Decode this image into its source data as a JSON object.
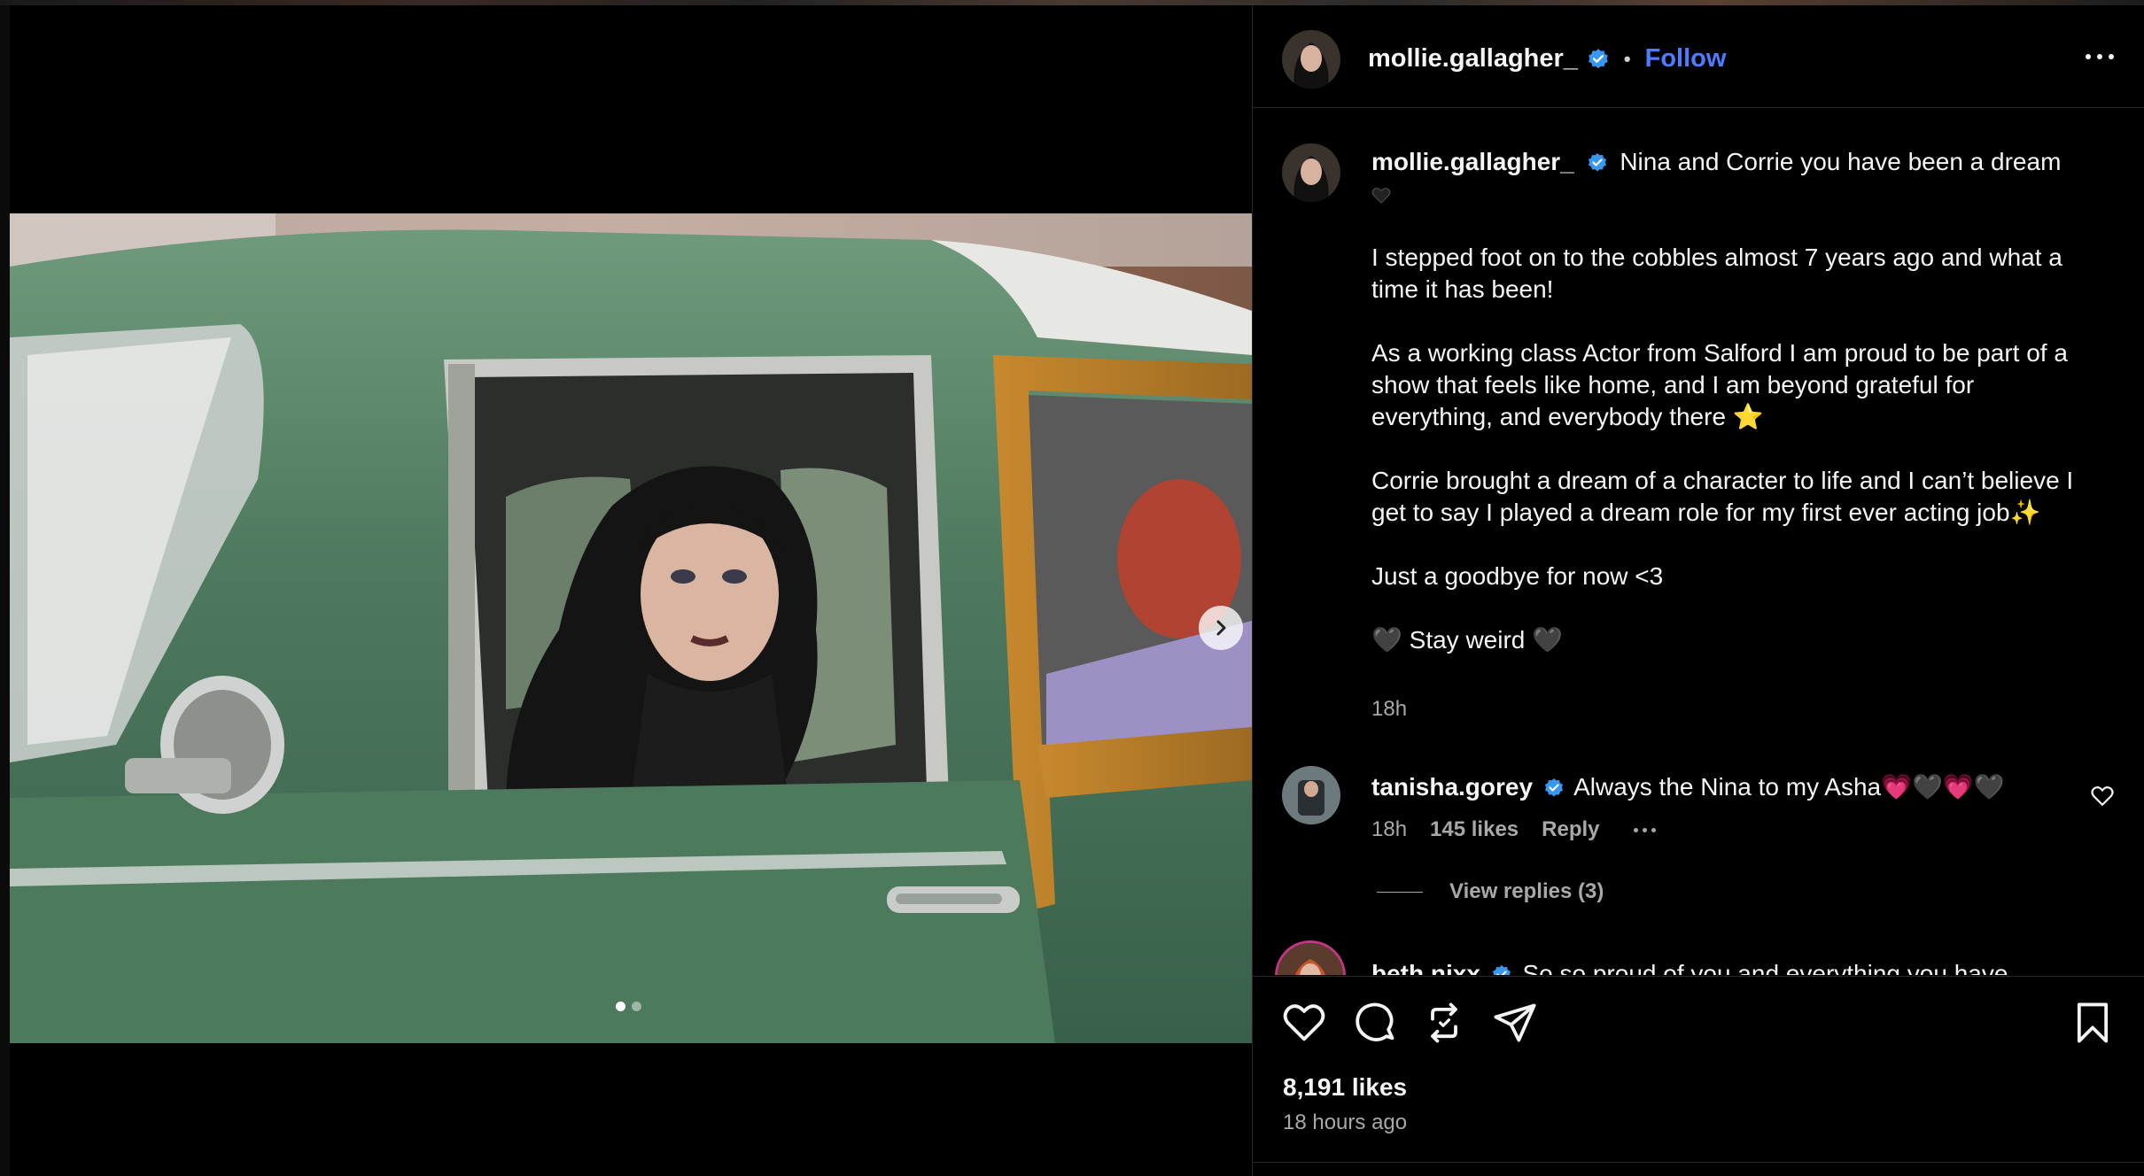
{
  "post": {
    "author": "mollie.gallagher_",
    "follow_label": "Follow",
    "separator": "•",
    "caption": {
      "username": "mollie.gallagher_",
      "line1": "Nina and Corrie you have been a dream",
      "paragraphs": [
        "I stepped foot on to the cobbles almost 7 years ago and what a time it has been!",
        "As a working class Actor from Salford I am proud to be part of a show that feels like home, and I am beyond grateful for everything, and everybody there ⭐",
        "Corrie brought a dream of a character to life and I can’t believe I get to say I played a dream role for my first ever acting job✨",
        "Just a goodbye for now <3",
        "🖤 Stay weird 🖤"
      ],
      "time": "18h"
    },
    "likes": "8,191 likes",
    "time_ago": "18 hours ago",
    "carousel": {
      "current": 1,
      "total": 2
    }
  },
  "comments": [
    {
      "username": "tanisha.gorey",
      "text": "Always the Nina to my Asha💗🖤💗🖤",
      "time": "18h",
      "likes": "145 likes",
      "reply_label": "Reply",
      "view_replies": "View replies (3)"
    },
    {
      "username": "beth.nixx",
      "text": "So so proud of you and everything you have"
    }
  ],
  "icons": {
    "verified": "verified-badge-icon",
    "more": "more-options-icon",
    "like": "heart-icon",
    "comment": "comment-icon",
    "repost": "repost-icon",
    "share": "share-icon",
    "save": "bookmark-icon",
    "next": "chevron-right-icon"
  },
  "colors": {
    "accent": "#4f7cff",
    "verified": "#3897f0",
    "panel_bg": "#000000",
    "secondary_text": "#a8a8a8"
  }
}
